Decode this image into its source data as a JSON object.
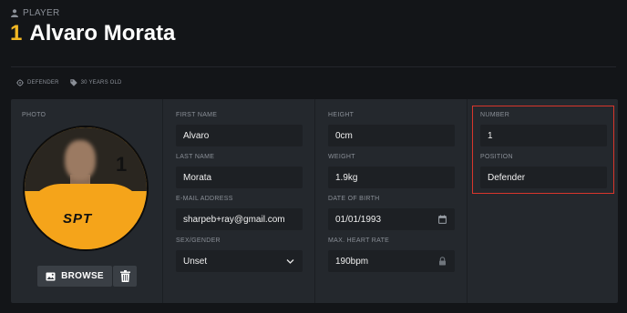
{
  "header": {
    "section_label": "PLAYER",
    "player_number": "1",
    "player_name": "Alvaro Morata"
  },
  "badges": {
    "position": "DEFENDER",
    "age": "30 YEARS OLD"
  },
  "photo": {
    "label": "PHOTO",
    "shirt_number": "1",
    "shirt_brand": "SPT",
    "browse_label": "BROWSE"
  },
  "form": {
    "first_name": {
      "label": "FIRST NAME",
      "value": "Alvaro"
    },
    "last_name": {
      "label": "LAST NAME",
      "value": "Morata"
    },
    "email": {
      "label": "E-MAIL ADDRESS",
      "value": "sharpeb+ray@gmail.com"
    },
    "gender": {
      "label": "SEX/GENDER",
      "value": "Unset"
    },
    "height": {
      "label": "HEIGHT",
      "value": "0cm"
    },
    "weight": {
      "label": "WEIGHT",
      "value": "1.9kg"
    },
    "dob": {
      "label": "DATE OF BIRTH",
      "value": "01/01/1993"
    },
    "max_hr": {
      "label": "MAX. HEART RATE",
      "value": "190bpm"
    },
    "number": {
      "label": "NUMBER",
      "value": "1"
    },
    "position": {
      "label": "POSITION",
      "value": "Defender"
    }
  },
  "colors": {
    "accent": "#f2b824",
    "highlight": "#d8362c",
    "panel": "#24282d",
    "background": "#131518"
  }
}
